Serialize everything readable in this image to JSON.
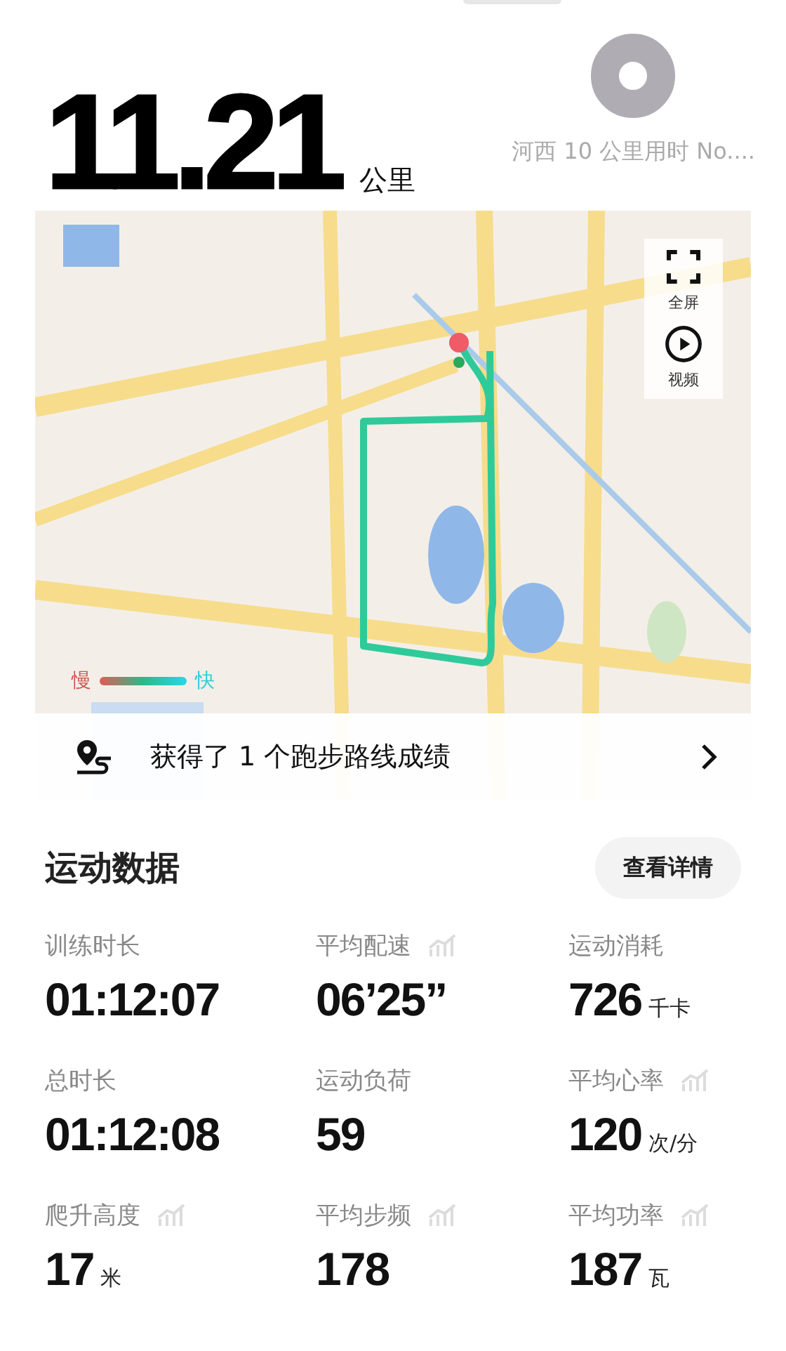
{
  "summary": {
    "distance": "11.21",
    "unit": "公里",
    "record_title": "河西 10 公里用时 No...."
  },
  "map": {
    "controls": [
      {
        "kind": "fullscreen",
        "label": "全屏"
      },
      {
        "kind": "video",
        "label": "视频"
      }
    ],
    "legend": {
      "slow": "慢",
      "fast": "快"
    },
    "achievement": {
      "text": "获得了 1 个跑步路线成绩"
    }
  },
  "section": {
    "title": "运动数据",
    "button": "查看详情"
  },
  "metrics": [
    {
      "label": "训练时长",
      "value": "01:12:07",
      "trend": false
    },
    {
      "label": "平均配速",
      "value": "06’25”",
      "trend": true
    },
    {
      "label": "运动消耗",
      "value": "726",
      "unit": "千卡",
      "trend": false
    },
    {
      "label": "总时长",
      "value": "01:12:08",
      "trend": false
    },
    {
      "label": "运动负荷",
      "value": "59",
      "trend": false
    },
    {
      "label": "平均心率",
      "value": "120",
      "unit": "次/分",
      "trend": true
    },
    {
      "label": "爬升高度",
      "value": "17",
      "unit": "米",
      "trend": true
    },
    {
      "label": "平均步频",
      "value": "178",
      "trend": true
    },
    {
      "label": "平均功率",
      "value": "187",
      "unit": "瓦",
      "trend": true
    }
  ]
}
